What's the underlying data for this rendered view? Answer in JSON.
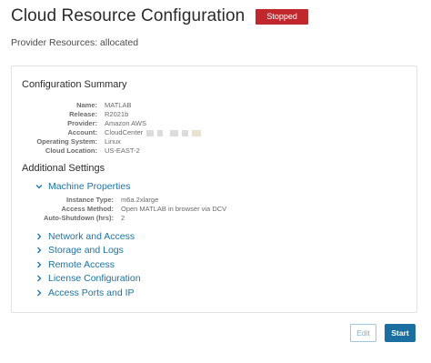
{
  "header": {
    "title": "Cloud Resource Configuration",
    "status": "Stopped"
  },
  "subtitle": "Provider Resources: allocated",
  "summary": {
    "title": "Configuration Summary",
    "rows": [
      {
        "label": "Name:",
        "value": "MATLAB"
      },
      {
        "label": "Release:",
        "value": "R2021b"
      },
      {
        "label": "Provider:",
        "value": "Amazon AWS"
      },
      {
        "label": "Account:",
        "value": "CloudCenter"
      },
      {
        "label": "Operating System:",
        "value": "Linux"
      },
      {
        "label": "Cloud Location:",
        "value": "US-EAST-2"
      }
    ]
  },
  "additional": {
    "title": "Additional Settings",
    "machine": {
      "label": "Machine Properties",
      "rows": [
        {
          "label": "Instance Type:",
          "value": "m6a.2xlarge"
        },
        {
          "label": "Access Method:",
          "value": "Open MATLAB in browser via DCV"
        },
        {
          "label": "Auto-Shutdown (hrs):",
          "value": "2"
        }
      ]
    },
    "sections": [
      {
        "label": "Network and Access"
      },
      {
        "label": "Storage and Logs"
      },
      {
        "label": "Remote Access"
      },
      {
        "label": "License Configuration"
      },
      {
        "label": "Access Ports and IP"
      }
    ]
  },
  "buttons": {
    "edit": "Edit",
    "start": "Start"
  },
  "colors": {
    "accent": "#1a73a8",
    "status": "#c0282d",
    "primary_button": "#1a6fa0"
  },
  "icons": {
    "expanded": "chevron-down-icon",
    "collapsed": "chevron-right-icon"
  }
}
